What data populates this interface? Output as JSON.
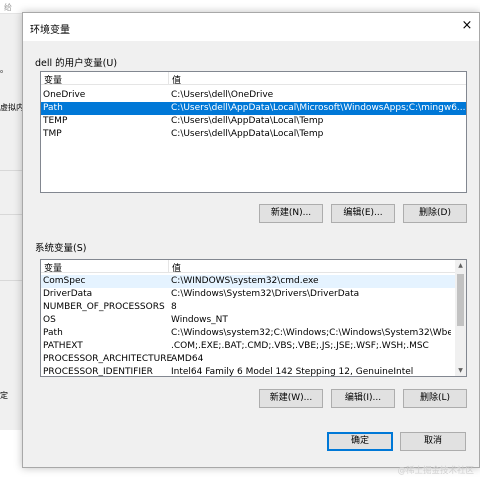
{
  "background_window": {
    "title_fragment": "给",
    "text_fragments": [
      "。",
      "虚拟内",
      "定"
    ]
  },
  "dialog": {
    "title": "环境变量",
    "close_glyph": "×"
  },
  "user_vars": {
    "label": "dell 的用户变量(U)",
    "col_variable": "变量",
    "col_value": "值",
    "rows": [
      {
        "name": "OneDrive",
        "value": "C:\\Users\\dell\\OneDrive"
      },
      {
        "name": "Path",
        "value": "C:\\Users\\dell\\AppData\\Local\\Microsoft\\WindowsApps;C:\\mingw6..."
      },
      {
        "name": "TEMP",
        "value": "C:\\Users\\dell\\AppData\\Local\\Temp"
      },
      {
        "name": "TMP",
        "value": "C:\\Users\\dell\\AppData\\Local\\Temp"
      }
    ],
    "selected_index": 1,
    "buttons": {
      "new": "新建(N)...",
      "edit": "编辑(E)...",
      "delete": "删除(D)"
    }
  },
  "system_vars": {
    "label": "系统变量(S)",
    "col_variable": "变量",
    "col_value": "值",
    "rows": [
      {
        "name": "ComSpec",
        "value": "C:\\WINDOWS\\system32\\cmd.exe"
      },
      {
        "name": "DriverData",
        "value": "C:\\Windows\\System32\\Drivers\\DriverData"
      },
      {
        "name": "NUMBER_OF_PROCESSORS",
        "value": "8"
      },
      {
        "name": "OS",
        "value": "Windows_NT"
      },
      {
        "name": "Path",
        "value": "C:\\Windows\\system32;C:\\Windows;C:\\Windows\\System32\\Wbem;..."
      },
      {
        "name": "PATHEXT",
        "value": ".COM;.EXE;.BAT;.CMD;.VBS;.VBE;.JS;.JSE;.WSF;.WSH;.MSC"
      },
      {
        "name": "PROCESSOR_ARCHITECTURE",
        "value": "AMD64"
      },
      {
        "name": "PROCESSOR_IDENTIFIER",
        "value": "Intel64 Family 6 Model 142 Stepping 12, GenuineIntel"
      }
    ],
    "hover_index": 0,
    "buttons": {
      "new": "新建(W)...",
      "edit": "编辑(I)...",
      "delete": "删除(L)"
    }
  },
  "footer": {
    "ok": "确定",
    "cancel": "取消"
  },
  "watermark": "@稀土掘金技术社区",
  "colors": {
    "selection": "#0078d7",
    "hover": "#e5f3ff",
    "dialog_bg": "#f0f0f0"
  }
}
